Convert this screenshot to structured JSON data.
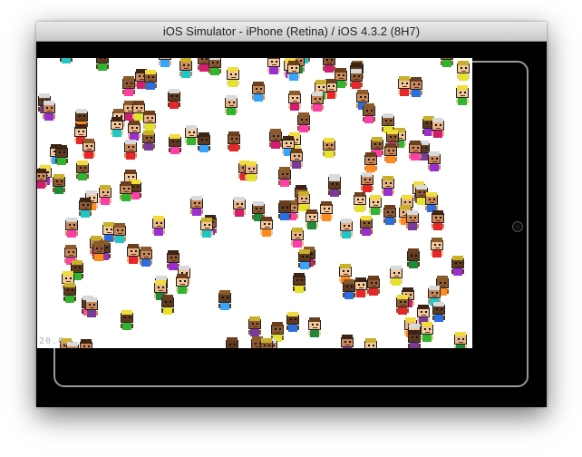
{
  "window": {
    "title": "iOS Simulator - iPhone (Retina) / iOS 4.3.2 (8H7)"
  },
  "app": {
    "fps_text": "20.0",
    "sprite_count": 170,
    "skin_colors": [
      "#f2c79a",
      "#e8b487",
      "#c8895a",
      "#8b5a32",
      "#5e3a1e"
    ],
    "hair_colors": [
      "#6b3e1e",
      "#3b2414",
      "#f0dd3c",
      "#c9b02a",
      "#d9d9d9",
      "#8a5a2a"
    ],
    "shirt_colors": [
      "#e5262a",
      "#2fb52f",
      "#2a6fe0",
      "#e3e32a",
      "#9b2ed0",
      "#ff8a1e",
      "#21c6c6",
      "#ff3fa8",
      "#7a3a9a",
      "#1e8a3a",
      "#35a6ff",
      "#d21e6e"
    ]
  }
}
